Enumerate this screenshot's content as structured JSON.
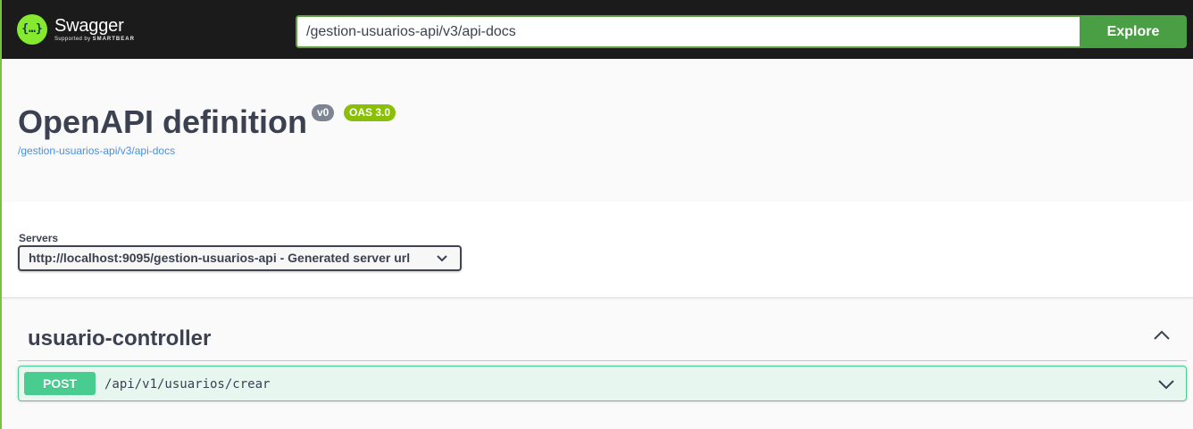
{
  "topbar": {
    "brand_name": "Swagger",
    "brand_sub_prefix": "Supported by",
    "brand_sub_company": "SMARTBEAR",
    "logo_glyph": "{…}",
    "url_value": "/gestion-usuarios-api/v3/api-docs",
    "explore_label": "Explore",
    "colors": {
      "bar": "#1b1b1b",
      "logo": "#85ea2d",
      "explore": "#4a9f45"
    }
  },
  "info": {
    "title": "OpenAPI definition",
    "version_badge": "v0",
    "oas_badge": "OAS 3.0",
    "spec_link": "/gestion-usuarios-api/v3/api-docs"
  },
  "servers": {
    "label": "Servers",
    "selected": "http://localhost:9095/gestion-usuarios-api - Generated server url"
  },
  "tags": [
    {
      "name": "usuario-controller",
      "expanded": true,
      "operations": [
        {
          "method": "POST",
          "path": "/api/v1/usuarios/crear",
          "color": "#49cc90"
        }
      ]
    }
  ]
}
